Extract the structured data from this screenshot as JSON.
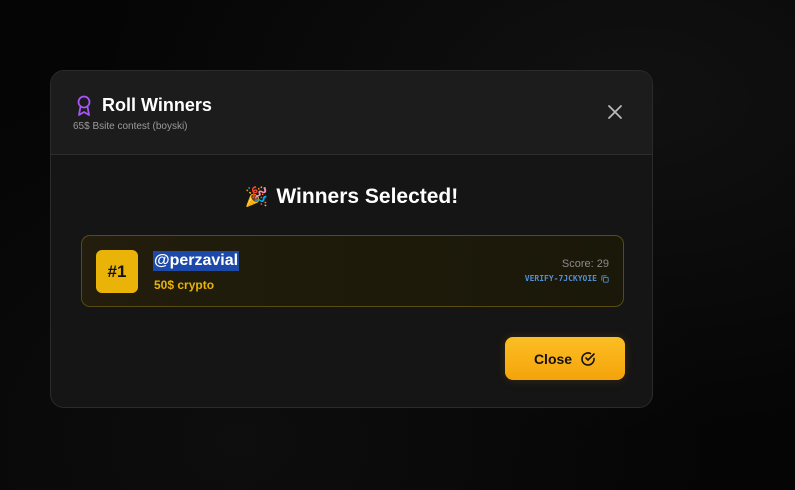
{
  "modal": {
    "title": "Roll Winners",
    "subtitle": "65$ Bsite contest (boyski)",
    "headline_emoji": "🎉",
    "headline": "Winners Selected!",
    "close_label": "Close"
  },
  "winners": [
    {
      "rank": "#1",
      "name": "@perzavial",
      "prize": "50$ crypto",
      "score": "Score: 29",
      "verify_code": "VERIFY-7JCKYOIE"
    }
  ],
  "colors": {
    "accent": "#eab308",
    "button": "#fbbf24",
    "title_icon": "#a855f7",
    "verify_link": "#4f8fd6",
    "selection": "#1d4aa8"
  },
  "icons": {
    "title": "award-icon",
    "dismiss": "close-icon",
    "copy": "copy-icon",
    "button": "check-circle-icon"
  }
}
